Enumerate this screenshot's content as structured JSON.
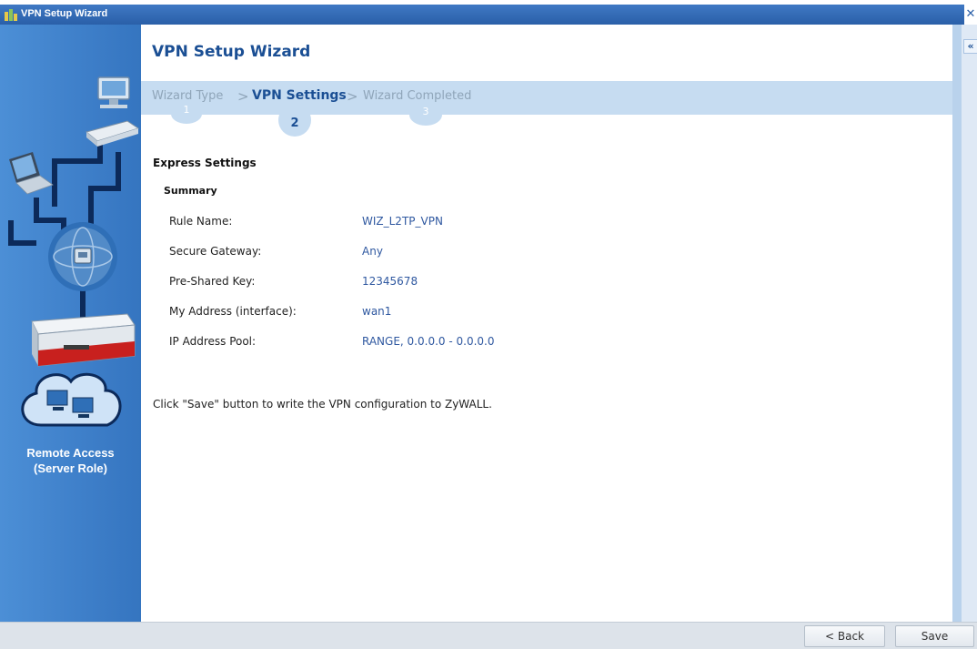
{
  "window": {
    "title": "VPN Setup Wizard",
    "close_glyph": "✕"
  },
  "sidebar": {
    "role_line1": "Remote Access",
    "role_line2": "(Server Role)"
  },
  "main": {
    "heading": "VPN Setup Wizard",
    "steps": [
      {
        "label": "Wizard Type",
        "number": "1",
        "active": false
      },
      {
        "label": "VPN Settings",
        "number": "2",
        "active": true
      },
      {
        "label": "Wizard Completed",
        "number": "3",
        "active": false
      }
    ],
    "step_separator": ">",
    "section_title": "Express Settings",
    "summary_title": "Summary",
    "summary_rows": [
      {
        "label": "Rule Name:",
        "value": "WIZ_L2TP_VPN"
      },
      {
        "label": "Secure Gateway:",
        "value": "Any"
      },
      {
        "label": "Pre-Shared Key:",
        "value": "12345678"
      },
      {
        "label": "My Address (interface):",
        "value": "wan1"
      },
      {
        "label": "IP Address Pool:",
        "value": "RANGE, 0.0.0.0 - 0.0.0.0"
      }
    ],
    "note": "Click \"Save\" button to write the VPN configuration to ZyWALL."
  },
  "rightbar": {
    "collapse_glyph": "«"
  },
  "footer": {
    "back_label": "< Back",
    "save_label": "Save"
  },
  "icons": {
    "title_icon": "wizard-icon",
    "sidebar_illustration": "vpn-remote-access-illustration"
  },
  "colors": {
    "title_bar": "#2a5fa8",
    "sidebar": "#3f80ca",
    "heading": "#1b4f94",
    "step_bar": "#c6dcf1",
    "value_text": "#2f58a0"
  }
}
